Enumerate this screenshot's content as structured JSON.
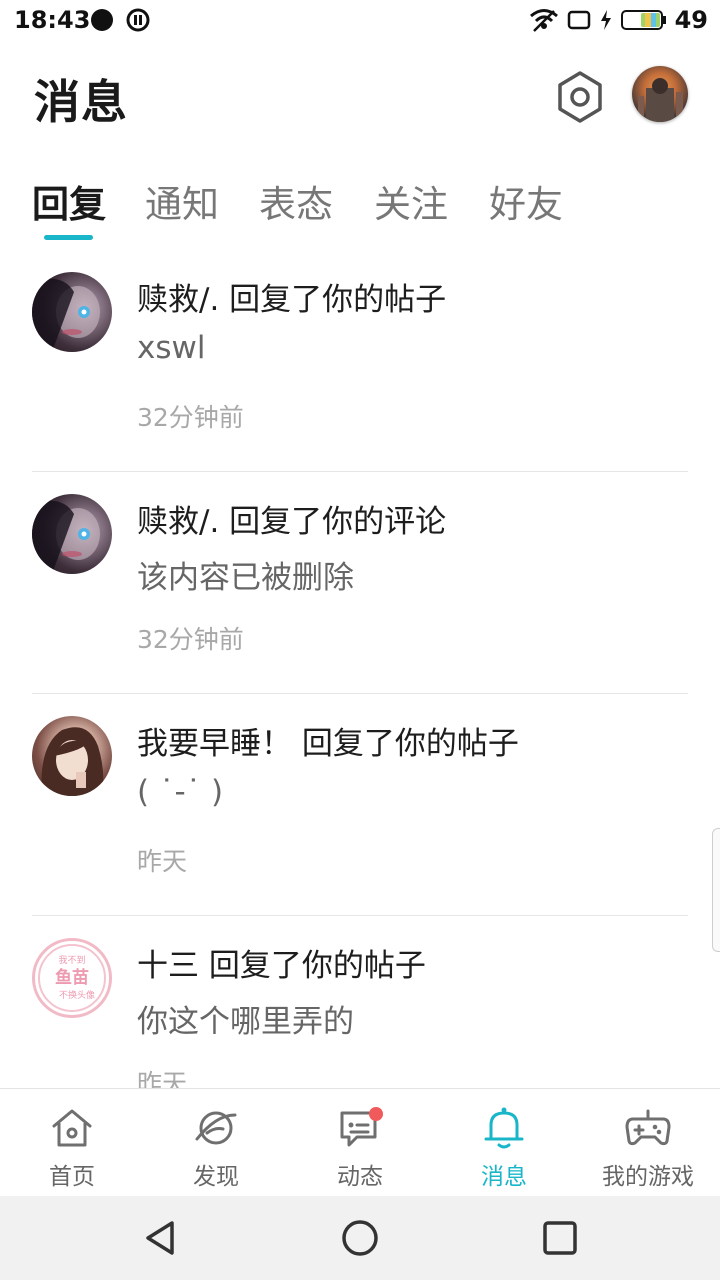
{
  "status_bar": {
    "time": "18:43",
    "battery_level": "49",
    "icons": [
      "notification-dot-icon",
      "pause-icon",
      "wifi-icon",
      "screen-icon",
      "charging-icon",
      "battery-icon"
    ]
  },
  "header": {
    "title": "消息",
    "settings_icon": "settings-hexagon-icon",
    "avatar_icon": "user-avatar"
  },
  "tabs": [
    {
      "label": "回复",
      "active": true
    },
    {
      "label": "通知",
      "active": false
    },
    {
      "label": "表态",
      "active": false
    },
    {
      "label": "关注",
      "active": false
    },
    {
      "label": "好友",
      "active": false
    }
  ],
  "messages": [
    {
      "title": "赎救/. 回复了你的帖子",
      "body": "xswl",
      "time": "32分钟前"
    },
    {
      "title": "赎救/. 回复了你的评论",
      "body": "该内容已被删除",
      "time": "32分钟前"
    },
    {
      "title": "我要早睡！ 回复了你的帖子",
      "body": "( ˙-˙ )",
      "time": "昨天"
    },
    {
      "title": "十三 回复了你的帖子",
      "body": "你这个哪里弄的",
      "time": "昨天",
      "avatar_text": [
        "我不到",
        "鱼苗",
        "不换头像"
      ]
    }
  ],
  "bottom_nav": [
    {
      "label": "首页",
      "icon": "home-icon",
      "active": false
    },
    {
      "label": "发现",
      "icon": "planet-icon",
      "active": false
    },
    {
      "label": "动态",
      "icon": "chat-icon",
      "active": false,
      "badge": true
    },
    {
      "label": "消息",
      "icon": "bell-icon",
      "active": true
    },
    {
      "label": "我的游戏",
      "icon": "gamepad-icon",
      "active": false
    }
  ],
  "colors": {
    "accent": "#19b6c9",
    "badge": "#f05a5a",
    "text_primary": "#1d1d1d",
    "text_secondary": "#666666",
    "text_muted": "#a8a8a8"
  }
}
